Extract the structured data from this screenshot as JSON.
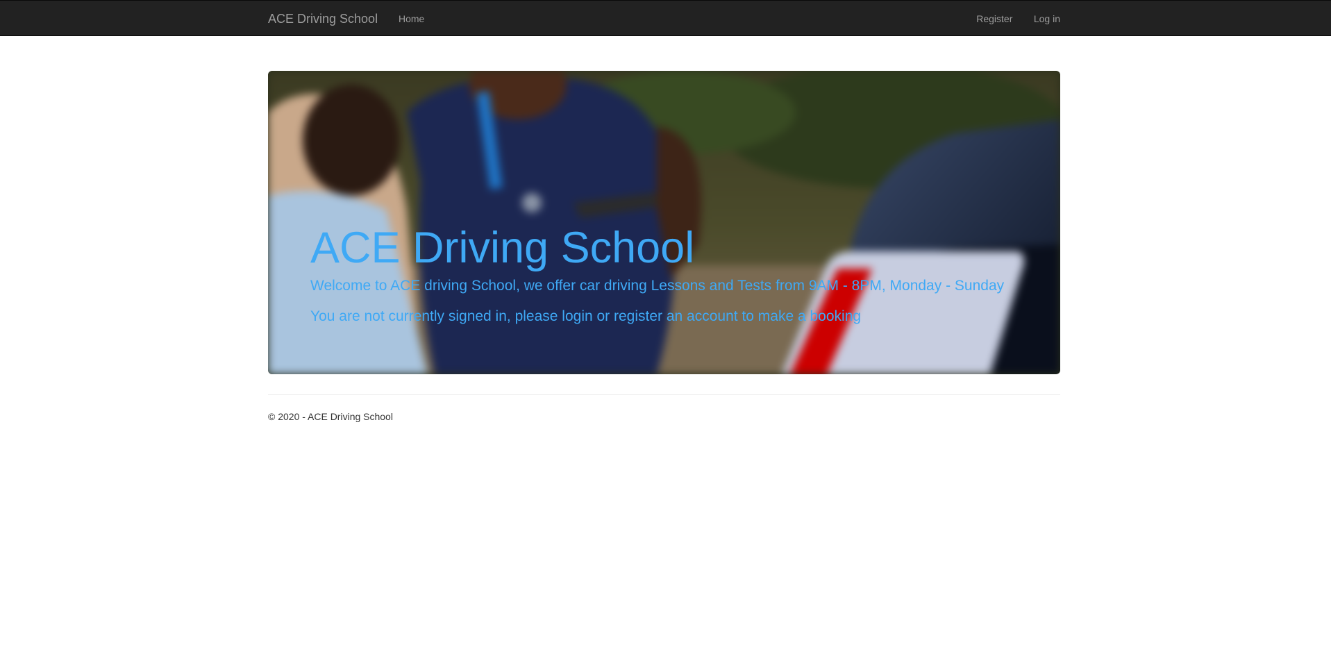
{
  "navbar": {
    "brand": "ACE Driving School",
    "links": [
      {
        "label": "Home"
      }
    ],
    "right_links": [
      {
        "label": "Register"
      },
      {
        "label": "Log in"
      }
    ]
  },
  "hero": {
    "title": "ACE Driving School",
    "intro": "Welcome to ACE driving School, we offer car driving Lessons and Tests from 9AM - 8PM, Monday - Sunday",
    "notice": "You are not currently signed in, please login or register an account to make a booking"
  },
  "footer": {
    "copyright": "© 2020 - ACE Driving School"
  },
  "colors": {
    "navbar_bg": "#222222",
    "nav_text": "#9d9d9d",
    "hero_text": "#3fa9f5"
  }
}
